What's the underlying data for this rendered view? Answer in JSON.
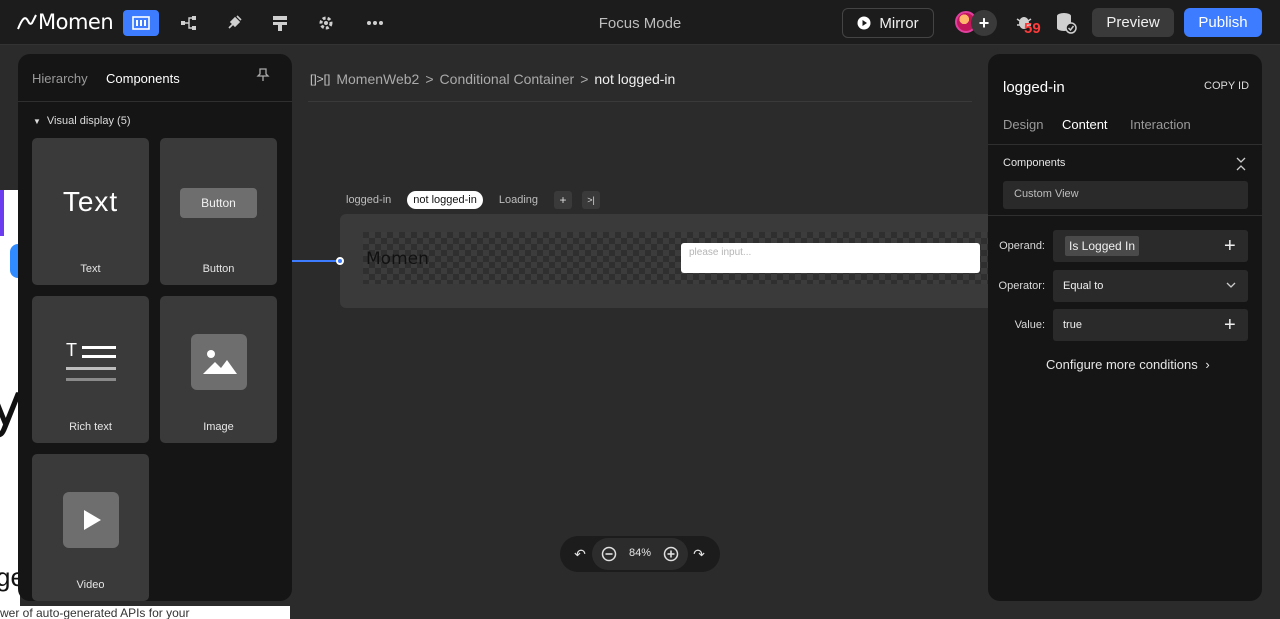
{
  "header": {
    "brand": "Momen",
    "focus_mode": "Focus Mode",
    "mirror": "Mirror",
    "bug_count": "59",
    "preview": "Preview",
    "publish": "Publish"
  },
  "left_panel": {
    "tabs": [
      "Hierarchy",
      "Components"
    ],
    "active_tab": "Components",
    "section": "Visual display (5)",
    "components": [
      {
        "label": "Text",
        "preview_text": "Text"
      },
      {
        "label": "Button",
        "preview_text": "Button"
      },
      {
        "label": "Rich text"
      },
      {
        "label": "Image"
      },
      {
        "label": "Video"
      }
    ]
  },
  "background_page": {
    "letter_y": "y",
    "letter_g": "ge",
    "bottom_text": "wer of auto-generated APIs for your"
  },
  "canvas": {
    "breadcrumb": {
      "icon": "[]>[]",
      "items": [
        "MomenWeb2",
        "Conditional Container"
      ],
      "current": "not logged-in",
      "sep": ">"
    },
    "state_tabs": [
      "logged-in",
      "not logged-in",
      "Loading"
    ],
    "active_state": "not logged-in",
    "add_icon": "+",
    "next_icon": ">|",
    "logo_text": "Momen",
    "input_placeholder": "please input...",
    "zoom": "84%"
  },
  "right_panel": {
    "title": "logged-in",
    "copy_id": "COPY ID",
    "tabs": [
      "Design",
      "Content",
      "Interaction"
    ],
    "active_tab": "Content",
    "components_label": "Components",
    "components_value": "Custom View",
    "operand_label": "Operand:",
    "operand_value": "Is Logged In",
    "operator_label": "Operator:",
    "operator_value": "Equal to",
    "value_label": "Value:",
    "value_value": "true",
    "more_conditions": "Configure more conditions"
  },
  "colors": {
    "accent": "#3d7bff",
    "bug_red": "#ff3b3b",
    "panel_bg": "#151515",
    "canvas_bg": "#2b2b2b"
  }
}
